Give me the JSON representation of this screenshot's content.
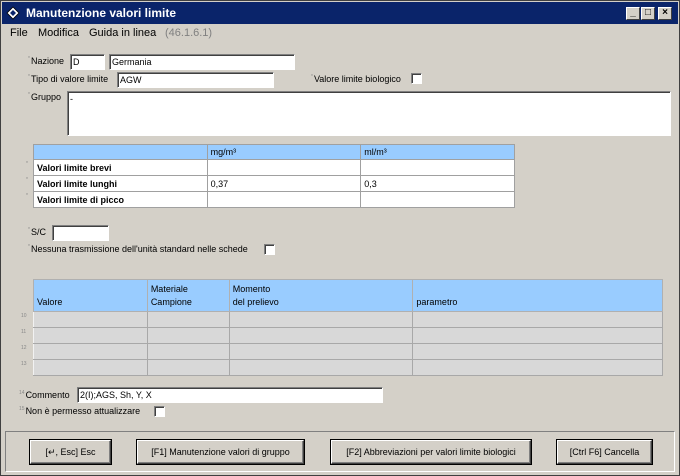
{
  "window": {
    "title": "Manutenzione valori limite"
  },
  "menu": {
    "file": "File",
    "modifica": "Modifica",
    "guida": "Guida in linea",
    "version": "(46.1.6.1)"
  },
  "form": {
    "nazione_label": "Nazione",
    "nazione_code": "D",
    "nazione_name": "Germania",
    "tipo_label": "Tipo di valore limite",
    "tipo_value": "AGW",
    "biologico_label": "Valore limite biologico",
    "gruppo_label": "Gruppo",
    "gruppo_value": "-",
    "sc_label": "S/C",
    "sc_value": "",
    "nessuna_label": "Nessuna trasmissione dell'unità standard nelle schede",
    "commento_label": "Commento",
    "commento_value": "2(I);AGS, Sh, Y, X",
    "non_permesso_label": "Non è permesso attualizzare"
  },
  "limits_table": {
    "headers": [
      "",
      "mg/m³",
      "ml/m³"
    ],
    "rows": [
      {
        "label": "Valori limite brevi",
        "mg": "",
        "ml": ""
      },
      {
        "label": "Valori limite lunghi",
        "mg": "0,37",
        "ml": "0,3"
      },
      {
        "label": "Valori limite di picco",
        "mg": "",
        "ml": ""
      }
    ]
  },
  "grid": {
    "headers": [
      {
        "line1": "",
        "line2": "Valore"
      },
      {
        "line1": "Materiale",
        "line2": "Campione"
      },
      {
        "line1": "Momento",
        "line2": "del prelievo"
      },
      {
        "line1": "",
        "line2": "parametro"
      }
    ],
    "row_numbers": [
      "10",
      "11",
      "12",
      "13"
    ]
  },
  "buttons": {
    "esc": "[↵, Esc] Esc",
    "f1": "[F1] Manutenzione valori di gruppo",
    "f2": "[F2] Abbreviazioni per valori limite biologici",
    "cancel": "[Ctrl F6] Cancella"
  }
}
